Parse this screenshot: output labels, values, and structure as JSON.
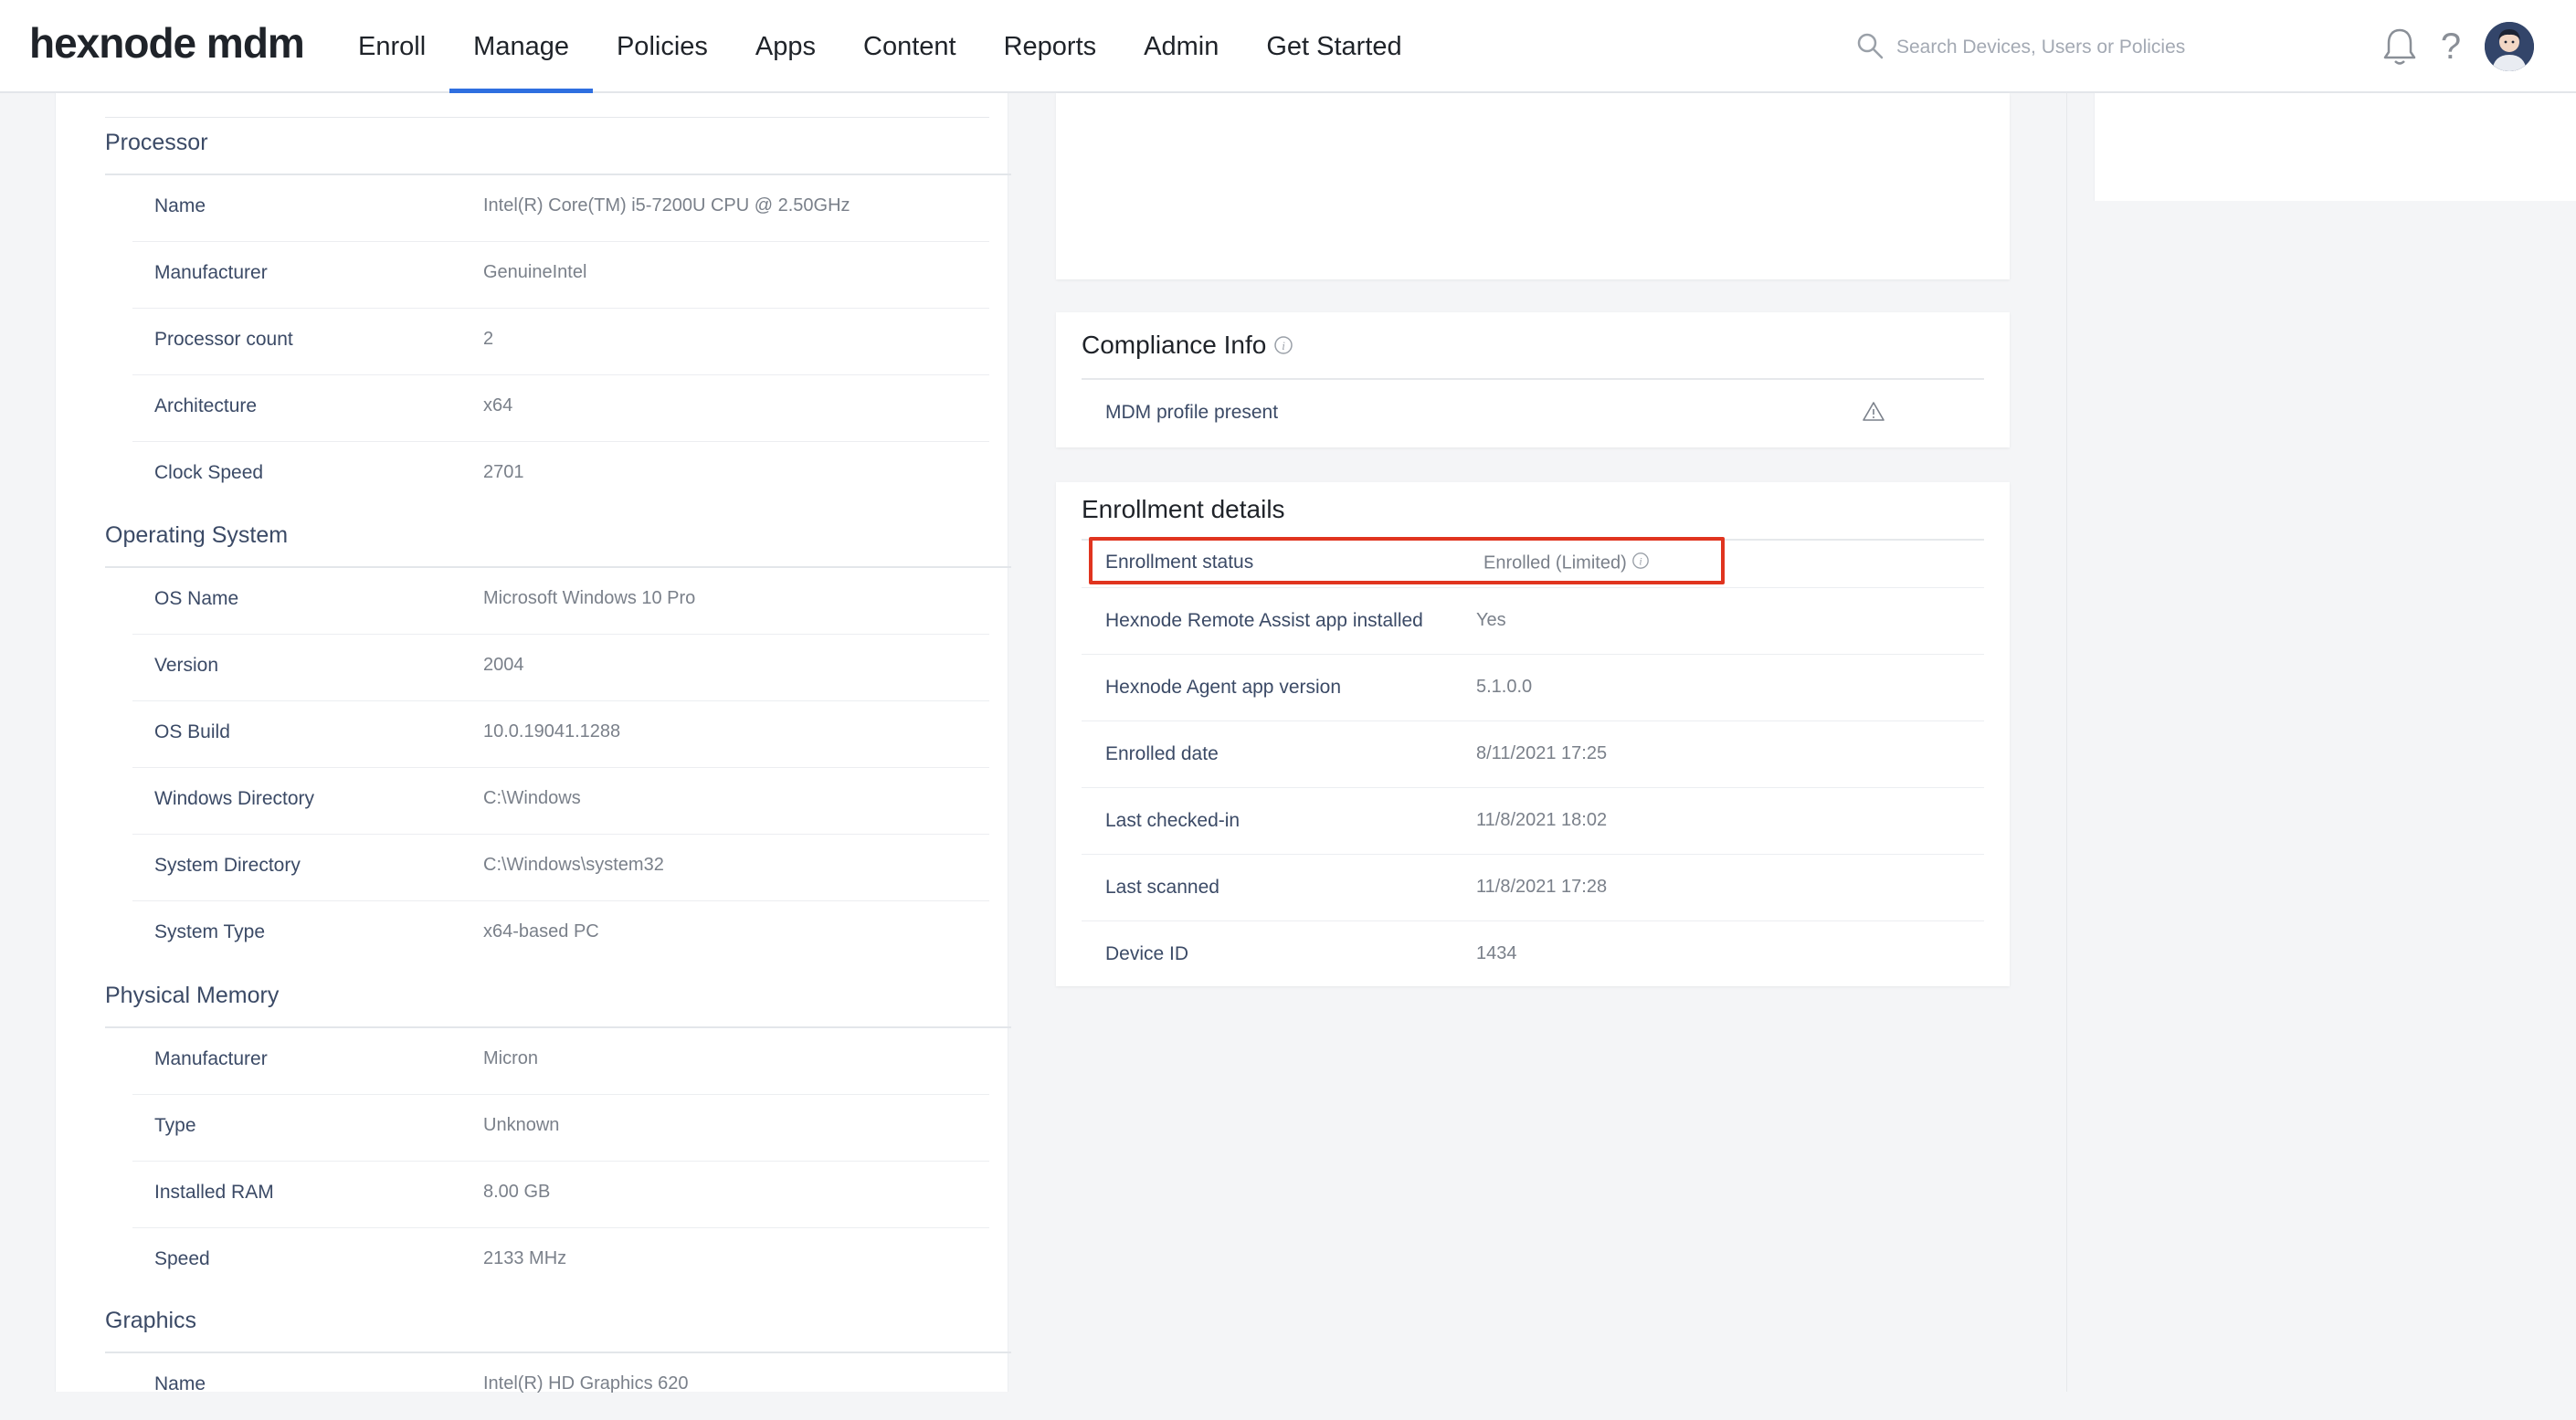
{
  "header": {
    "logo": "hexnode mdm",
    "nav": [
      {
        "label": "Enroll"
      },
      {
        "label": "Manage",
        "active": true
      },
      {
        "label": "Policies"
      },
      {
        "label": "Apps"
      },
      {
        "label": "Content"
      },
      {
        "label": "Reports"
      },
      {
        "label": "Admin"
      },
      {
        "label": "Get Started"
      }
    ],
    "search_placeholder": "Search Devices, Users or Policies",
    "help_glyph": "?"
  },
  "left": {
    "sections": [
      {
        "title": "Processor",
        "rows": [
          {
            "label": "Name",
            "value": "Intel(R) Core(TM) i5-7200U CPU @ 2.50GHz"
          },
          {
            "label": "Manufacturer",
            "value": "GenuineIntel"
          },
          {
            "label": "Processor count",
            "value": "2"
          },
          {
            "label": "Architecture",
            "value": "x64"
          },
          {
            "label": "Clock Speed",
            "value": "2701"
          }
        ]
      },
      {
        "title": "Operating System",
        "rows": [
          {
            "label": "OS Name",
            "value": "Microsoft Windows 10 Pro"
          },
          {
            "label": "Version",
            "value": "2004"
          },
          {
            "label": "OS Build",
            "value": "10.0.19041.1288"
          },
          {
            "label": "Windows Directory",
            "value": "C:\\Windows"
          },
          {
            "label": "System Directory",
            "value": "C:\\Windows\\system32"
          },
          {
            "label": "System Type",
            "value": "x64-based PC"
          }
        ]
      },
      {
        "title": "Physical Memory",
        "rows": [
          {
            "label": "Manufacturer",
            "value": "Micron"
          },
          {
            "label": "Type",
            "value": "Unknown"
          },
          {
            "label": "Installed RAM",
            "value": "8.00 GB"
          },
          {
            "label": "Speed",
            "value": "2133 MHz"
          }
        ]
      },
      {
        "title": "Graphics",
        "rows": [
          {
            "label": "Name",
            "value": "Intel(R) HD Graphics 620"
          }
        ]
      }
    ]
  },
  "compliance": {
    "title": "Compliance Info",
    "rows": [
      {
        "label": "MDM profile present"
      }
    ]
  },
  "enrollment": {
    "title": "Enrollment details",
    "rows": [
      {
        "label": "Enrollment status",
        "value": "Enrolled (Limited)"
      },
      {
        "label": "Hexnode Remote Assist app installed",
        "value": "Yes"
      },
      {
        "label": "Hexnode Agent app version",
        "value": "5.1.0.0"
      },
      {
        "label": "Enrolled date",
        "value": "8/11/2021 17:25"
      },
      {
        "label": "Last checked-in",
        "value": "11/8/2021 18:02"
      },
      {
        "label": "Last scanned",
        "value": "11/8/2021 17:28"
      },
      {
        "label": "Device ID",
        "value": "1434"
      }
    ]
  },
  "colors": {
    "accent": "#2f6fe0",
    "highlight": "#e0341f",
    "label": "#3b4a66",
    "value": "#7a808a"
  }
}
